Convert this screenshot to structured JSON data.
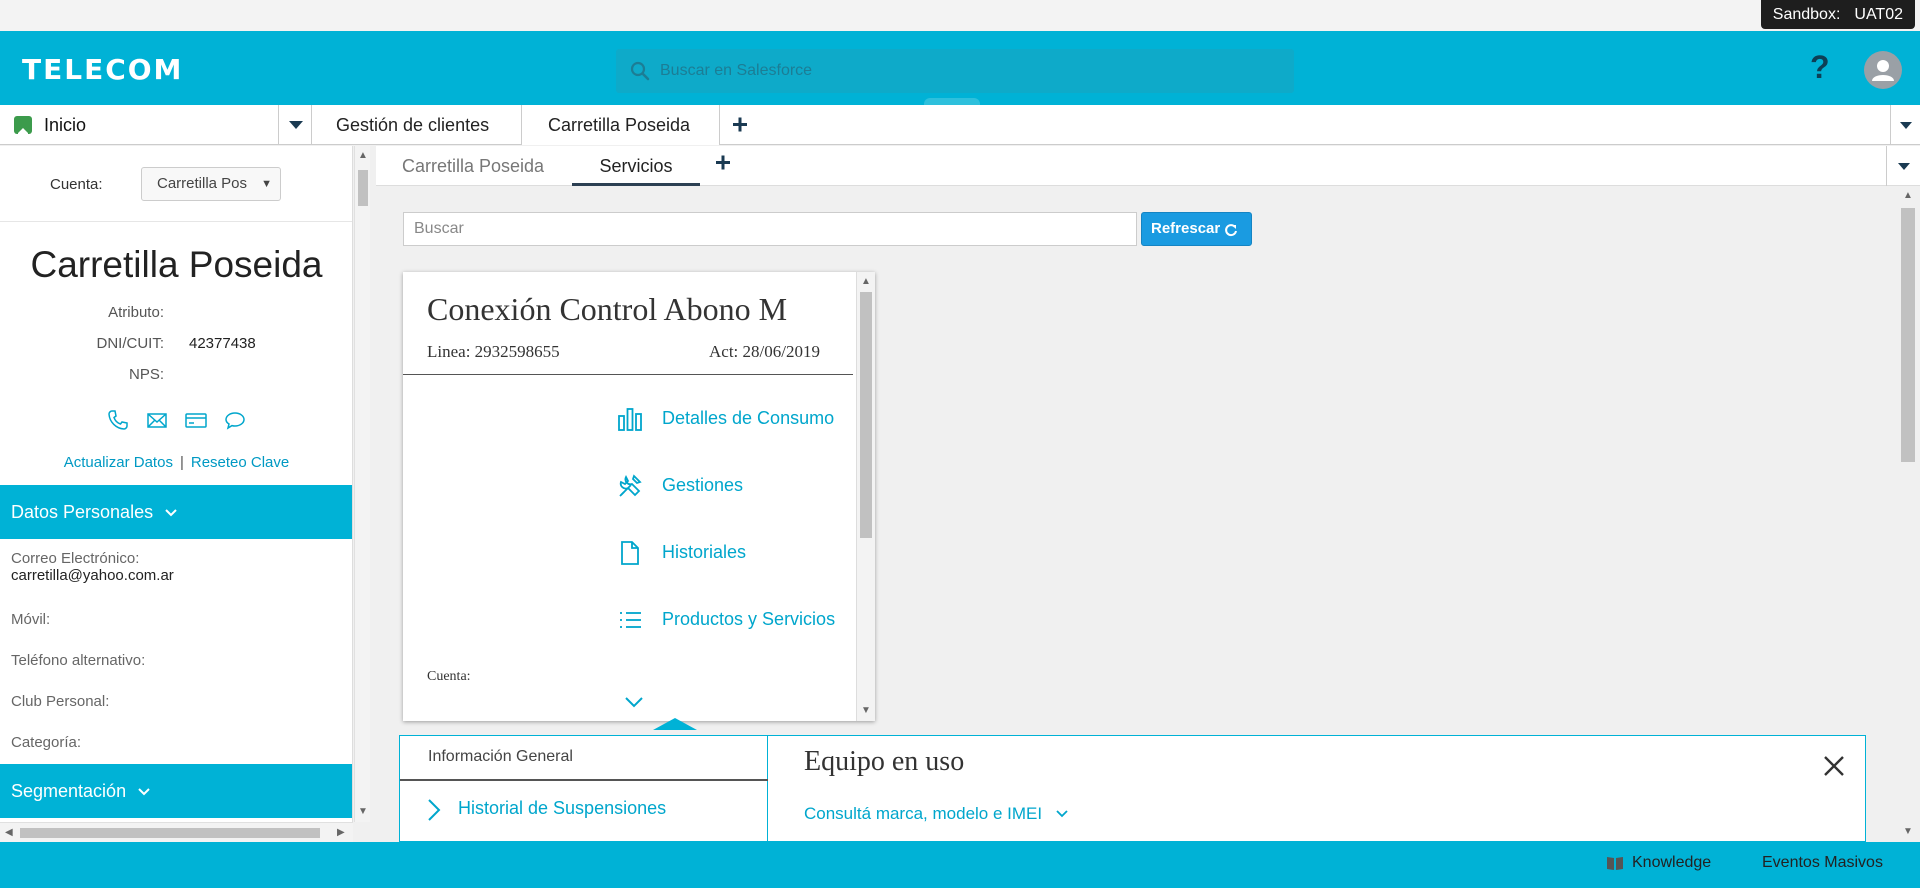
{
  "sandbox": {
    "label": "Sandbox:",
    "name": "UAT02"
  },
  "header": {
    "logo": "TELECOM",
    "search_placeholder": "Buscar en Salesforce",
    "help": "?"
  },
  "tabs": {
    "home": "Inicio",
    "items": [
      "Gestión de clientes",
      "Carretilla Poseida"
    ],
    "add": "+"
  },
  "left": {
    "cuenta_label": "Cuenta:",
    "cuenta_value": "Carretilla Pos",
    "account_name": "Carretilla Poseida",
    "attributes": [
      {
        "key": "Atributo:",
        "value": ""
      },
      {
        "key": "DNI/CUIT:",
        "value": "42377438"
      },
      {
        "key": "NPS:",
        "value": ""
      }
    ],
    "links": {
      "update": "Actualizar Datos",
      "sep": "|",
      "reset": "Reseteo Clave"
    },
    "section_datos": "Datos Personales",
    "fields": [
      {
        "key": "Correo Electrónico:",
        "value": "carretilla@yahoo.com.ar"
      },
      {
        "key": "Móvil:",
        "value": ""
      },
      {
        "key": "Teléfono alternativo:",
        "value": ""
      },
      {
        "key": "Club Personal:",
        "value": ""
      },
      {
        "key": "Categoría:",
        "value": ""
      }
    ],
    "section_seg": "Segmentación"
  },
  "subtabs": {
    "items": [
      "Carretilla Poseida",
      "Servicios"
    ],
    "add": "+"
  },
  "main": {
    "search_placeholder": "Buscar",
    "refresh_label": "Refrescar"
  },
  "card": {
    "title": "Conexión Control Abono M",
    "linea": "Linea: 2932598655",
    "act": "Act: 28/06/2019",
    "actions": [
      "Detalles de Consumo",
      "Gestiones",
      "Historiales",
      "Productos y Servicios"
    ],
    "cuenta": "Cuenta:"
  },
  "detail": {
    "info_general": "Información General",
    "historial": "Historial de Suspensiones",
    "equipo_title": "Equipo en uso",
    "equipo_link": "Consultá marca, modelo e IMEI"
  },
  "footer": {
    "knowledge": "Knowledge",
    "eventos": "Eventos Masivos"
  },
  "colors": {
    "brand": "#00b2d6",
    "link": "#00a6cc",
    "button": "#1a9be1"
  }
}
